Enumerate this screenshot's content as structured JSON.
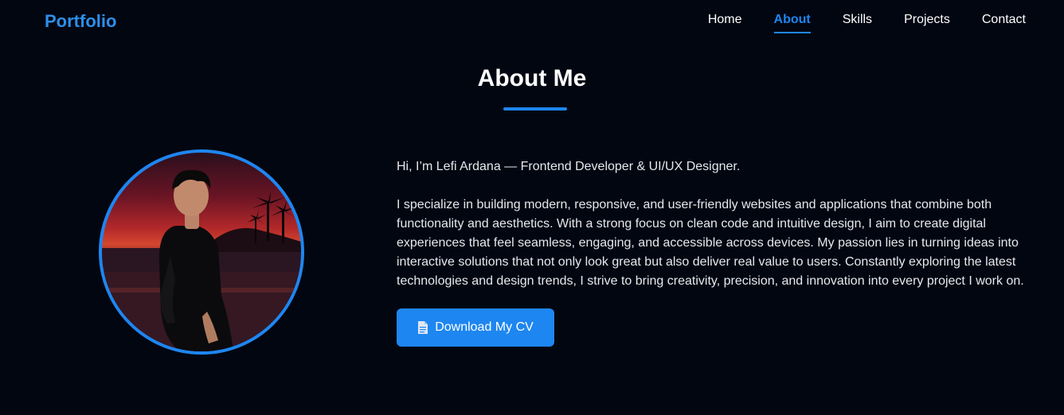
{
  "nav": {
    "brand": "Portfolio",
    "links": [
      {
        "label": "Home",
        "active": false
      },
      {
        "label": "About",
        "active": true
      },
      {
        "label": "Skills",
        "active": false
      },
      {
        "label": "Projects",
        "active": false
      },
      {
        "label": "Contact",
        "active": false
      }
    ]
  },
  "about": {
    "title": "About Me",
    "intro": "Hi, I’m Lefi Ardana — Frontend Developer & UI/UX Designer.",
    "body": "I specialize in building modern, responsive, and user-friendly websites and applications that combine both functionality and aesthetics. With a strong focus on clean code and intuitive design, I aim to create digital experiences that feel seamless, engaging, and accessible across devices. My passion lies in turning ideas into interactive solutions that not only look great but also deliver real value to users. Constantly exploring the latest technologies and design trends, I strive to bring creativity, precision, and innovation into every project I work on.",
    "cv_button": "Download My CV",
    "cv_icon": "document-icon",
    "photo_icon": "profile-photo"
  },
  "colors": {
    "background": "#020611",
    "accent": "#1e86f0",
    "brand": "#2d8fea",
    "text": "#e6e8ee"
  }
}
